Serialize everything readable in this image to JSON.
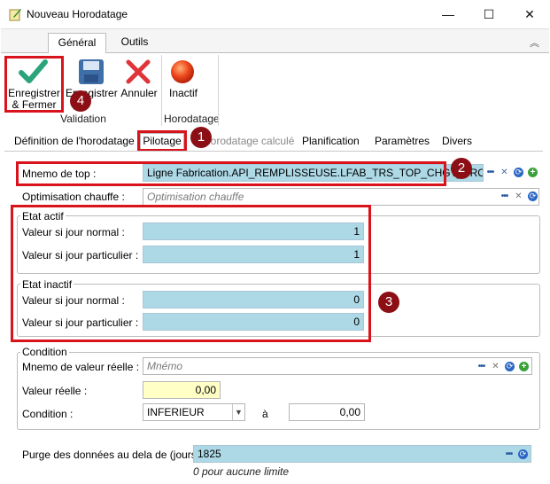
{
  "window": {
    "title": "Nouveau Horodatage",
    "minimize_symbol": "—",
    "maximize_symbol": "☐",
    "close_symbol": "✕"
  },
  "ribbon": {
    "tabs": [
      "Général",
      "Outils"
    ],
    "collapse_symbol": "︽",
    "buttons": {
      "save_close_line1": "Enregistrer",
      "save_close_line2": "& Fermer",
      "save": "Enregistrer",
      "cancel": "Annuler",
      "inactive": "Inactif"
    },
    "groups": {
      "validation": "Validation",
      "horodatage": "Horodatage"
    }
  },
  "tabs": {
    "definition": "Définition de l'horodatage",
    "pilotage": "Pilotage",
    "calcule": "Horodatage calculé",
    "planification": "Planification",
    "parametres": "Paramètres",
    "divers": "Divers"
  },
  "form": {
    "mnemo_top": {
      "label": "Mnemo de top :",
      "value": "Ligne Fabrication.API_REMPLISSEUSE.LFAB_TRS_TOP_CHGT_PROD"
    },
    "optimisation": {
      "label": "Optimisation chauffe :",
      "placeholder": "Optimisation chauffe"
    },
    "etat_actif": {
      "legend": "Etat actif",
      "normal_label": "Valeur si jour normal :",
      "normal_value": "1",
      "particulier_label": "Valeur si jour particulier :",
      "particulier_value": "1"
    },
    "etat_inactif": {
      "legend": "Etat inactif",
      "normal_label": "Valeur si jour normal :",
      "normal_value": "0",
      "particulier_label": "Valeur si jour particulier :",
      "particulier_value": "0"
    },
    "condition": {
      "legend": "Condition",
      "mnemo_label": "Mnemo de valeur réelle :",
      "mnemo_placeholder": "Mnémo",
      "valeur_label": "Valeur réelle :",
      "valeur_value": "0,00",
      "condition_label": "Condition :",
      "condition_value": "INFERIEUR",
      "a_label": "à",
      "a_value": "0,00"
    },
    "purge": {
      "label": "Purge des données au dela de (jours) :",
      "value": "1825",
      "hint": "0 pour aucune limite"
    }
  },
  "annotations": {
    "n1": "1",
    "n2": "2",
    "n3": "3",
    "n4": "4"
  },
  "colors": {
    "field_blue": "#add8e6",
    "highlight_red": "#d9131b",
    "badge": "#8b0f14"
  }
}
